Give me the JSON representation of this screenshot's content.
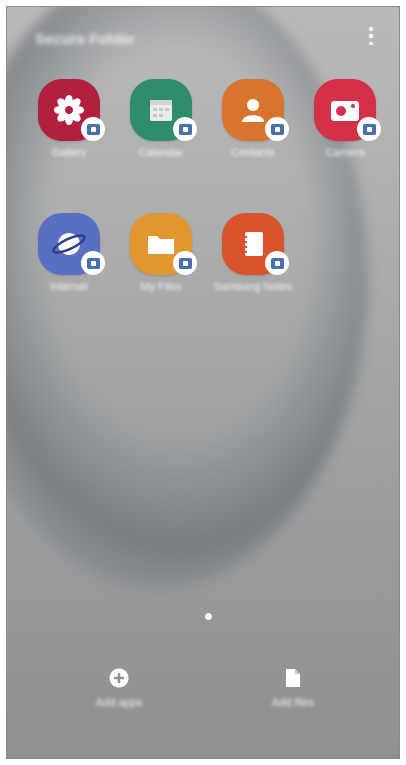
{
  "folder": {
    "title": "Secure Folder"
  },
  "apps": [
    {
      "label": "Gallery",
      "color": "#b2203f",
      "icon": "gallery-flower-icon"
    },
    {
      "label": "Calendar",
      "color": "#2f8c6c",
      "icon": "calendar-icon"
    },
    {
      "label": "Contacts",
      "color": "#d8742d",
      "icon": "contacts-person-icon"
    },
    {
      "label": "Camera",
      "color": "#d4304a",
      "icon": "camera-icon"
    },
    {
      "label": "Internet",
      "color": "#5a6fc4",
      "icon": "internet-planet-icon"
    },
    {
      "label": "My Files",
      "color": "#e2962f",
      "icon": "folder-icon"
    },
    {
      "label": "Samsung Notes",
      "color": "#d9532d",
      "icon": "notes-icon"
    }
  ],
  "badge_color": "#4a6fb0",
  "bottom": {
    "add_apps": "Add apps",
    "add_files": "Add files"
  }
}
